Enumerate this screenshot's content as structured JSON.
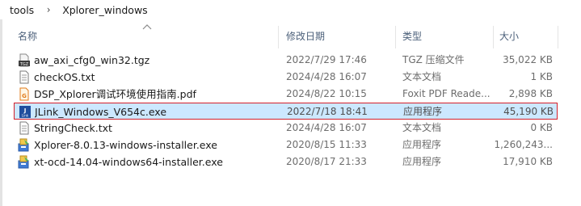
{
  "breadcrumb": {
    "items": [
      "tools",
      "Xplorer_windows"
    ],
    "separator": "›"
  },
  "columns": {
    "name": "名称",
    "date": "修改日期",
    "type": "类型",
    "size": "大小"
  },
  "files": [
    {
      "name": "aw_axi_cfg0_win32.tgz",
      "date": "2022/7/29 17:46",
      "type": "TGZ 压缩文件",
      "size": "35,022 KB",
      "icon": "tgz-archive-icon"
    },
    {
      "name": "checkOS.txt",
      "date": "2024/4/28 16:07",
      "type": "文本文档",
      "size": "1 KB",
      "icon": "text-file-icon"
    },
    {
      "name": "DSP_Xplorer调试环境使用指南.pdf",
      "date": "2024/8/22 10:15",
      "type": "Foxit PDF Reade...",
      "size": "2,898 KB",
      "icon": "pdf-file-icon"
    },
    {
      "name": "JLink_Windows_V654c.exe",
      "date": "2022/7/18 18:41",
      "type": "应用程序",
      "size": "45,190 KB",
      "icon": "jlink-exe-icon",
      "selected": true
    },
    {
      "name": "StringCheck.txt",
      "date": "2024/4/28 16:07",
      "type": "文本文档",
      "size": "0 KB",
      "icon": "text-file-icon"
    },
    {
      "name": "Xplorer-8.0.13-windows-installer.exe",
      "date": "2020/8/15 11:33",
      "type": "应用程序",
      "size": "1,260,243...",
      "icon": "installer-exe-icon"
    },
    {
      "name": "xt-ocd-14.04-windows64-installer.exe",
      "date": "2020/8/17 21:33",
      "type": "应用程序",
      "size": "17,910 KB",
      "icon": "installer-exe-icon"
    }
  ],
  "colors": {
    "selection_background": "#cce8ff",
    "selection_border": "#d4202a",
    "header_text": "#4c607a"
  }
}
